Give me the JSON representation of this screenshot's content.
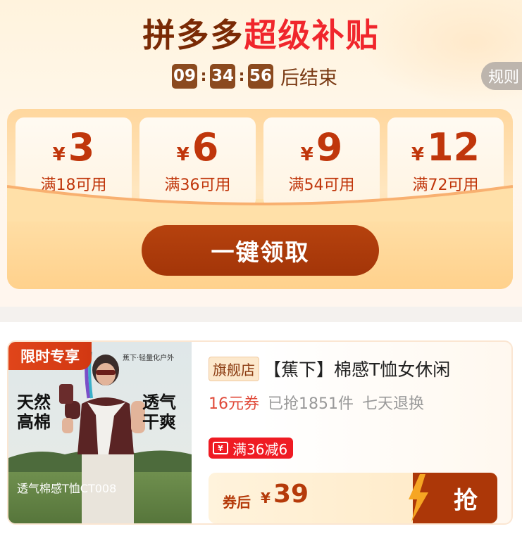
{
  "promo": {
    "title_part1": "拼多多",
    "title_part2": "超级补贴",
    "countdown": {
      "hours": "09",
      "minutes": "34",
      "seconds": "56",
      "suffix": "后结束",
      "sep": ":"
    },
    "rules_label": "规则",
    "coupons": [
      {
        "currency": "¥",
        "amount": "3",
        "condition": "满18可用"
      },
      {
        "currency": "¥",
        "amount": "6",
        "condition": "满36可用"
      },
      {
        "currency": "¥",
        "amount": "9",
        "condition": "满54可用"
      },
      {
        "currency": "¥",
        "amount": "12",
        "condition": "满72可用"
      }
    ],
    "claim_button": "一键领取",
    "colors": {
      "title_dark": "#7a2a05",
      "title_red": "#f0262c",
      "accent": "#a33508"
    }
  },
  "product": {
    "badge": "限时专享",
    "brand_mark": "蕉下·轻量化户外",
    "image_tags": {
      "left": "天然\n高棉",
      "right": "透气\n干爽"
    },
    "image_caption": "透气棉感T恤CT008",
    "store_tag": "旗舰店",
    "title": "【蕉下】棉感T恤女休闲",
    "coupon_info": "16元券",
    "sold": "已抢1851件",
    "return_policy": "七天退换",
    "discount": "满36减6",
    "ticket_symbol": "¥",
    "price_label": "券后",
    "price_currency": "¥",
    "price": "39",
    "grab_button": "抢"
  }
}
